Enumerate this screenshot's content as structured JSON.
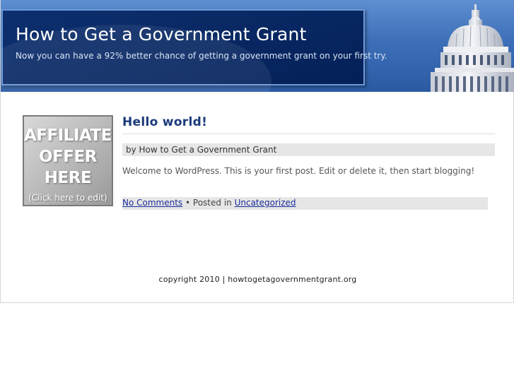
{
  "header": {
    "title": "How to Get a Government Grant",
    "tagline": "Now you can have a 92% better chance of getting a government grant on your first try."
  },
  "sidebar_ad": {
    "line1": "AFFILIATE",
    "line2": "OFFER",
    "line3": "HERE",
    "subtext": "(Click here to edit)"
  },
  "post": {
    "title": "Hello world!",
    "byline": "by How to Get a Government Grant",
    "content": "Welcome to WordPress. This is your first post. Edit or delete it, then start blogging!",
    "comments_link": "No Comments",
    "bullet_posted_in": " • Posted in ",
    "category_link": "Uncategorized"
  },
  "footer": {
    "copyright": "copyright 2010 | howtogetagovernmentgrant.org"
  }
}
